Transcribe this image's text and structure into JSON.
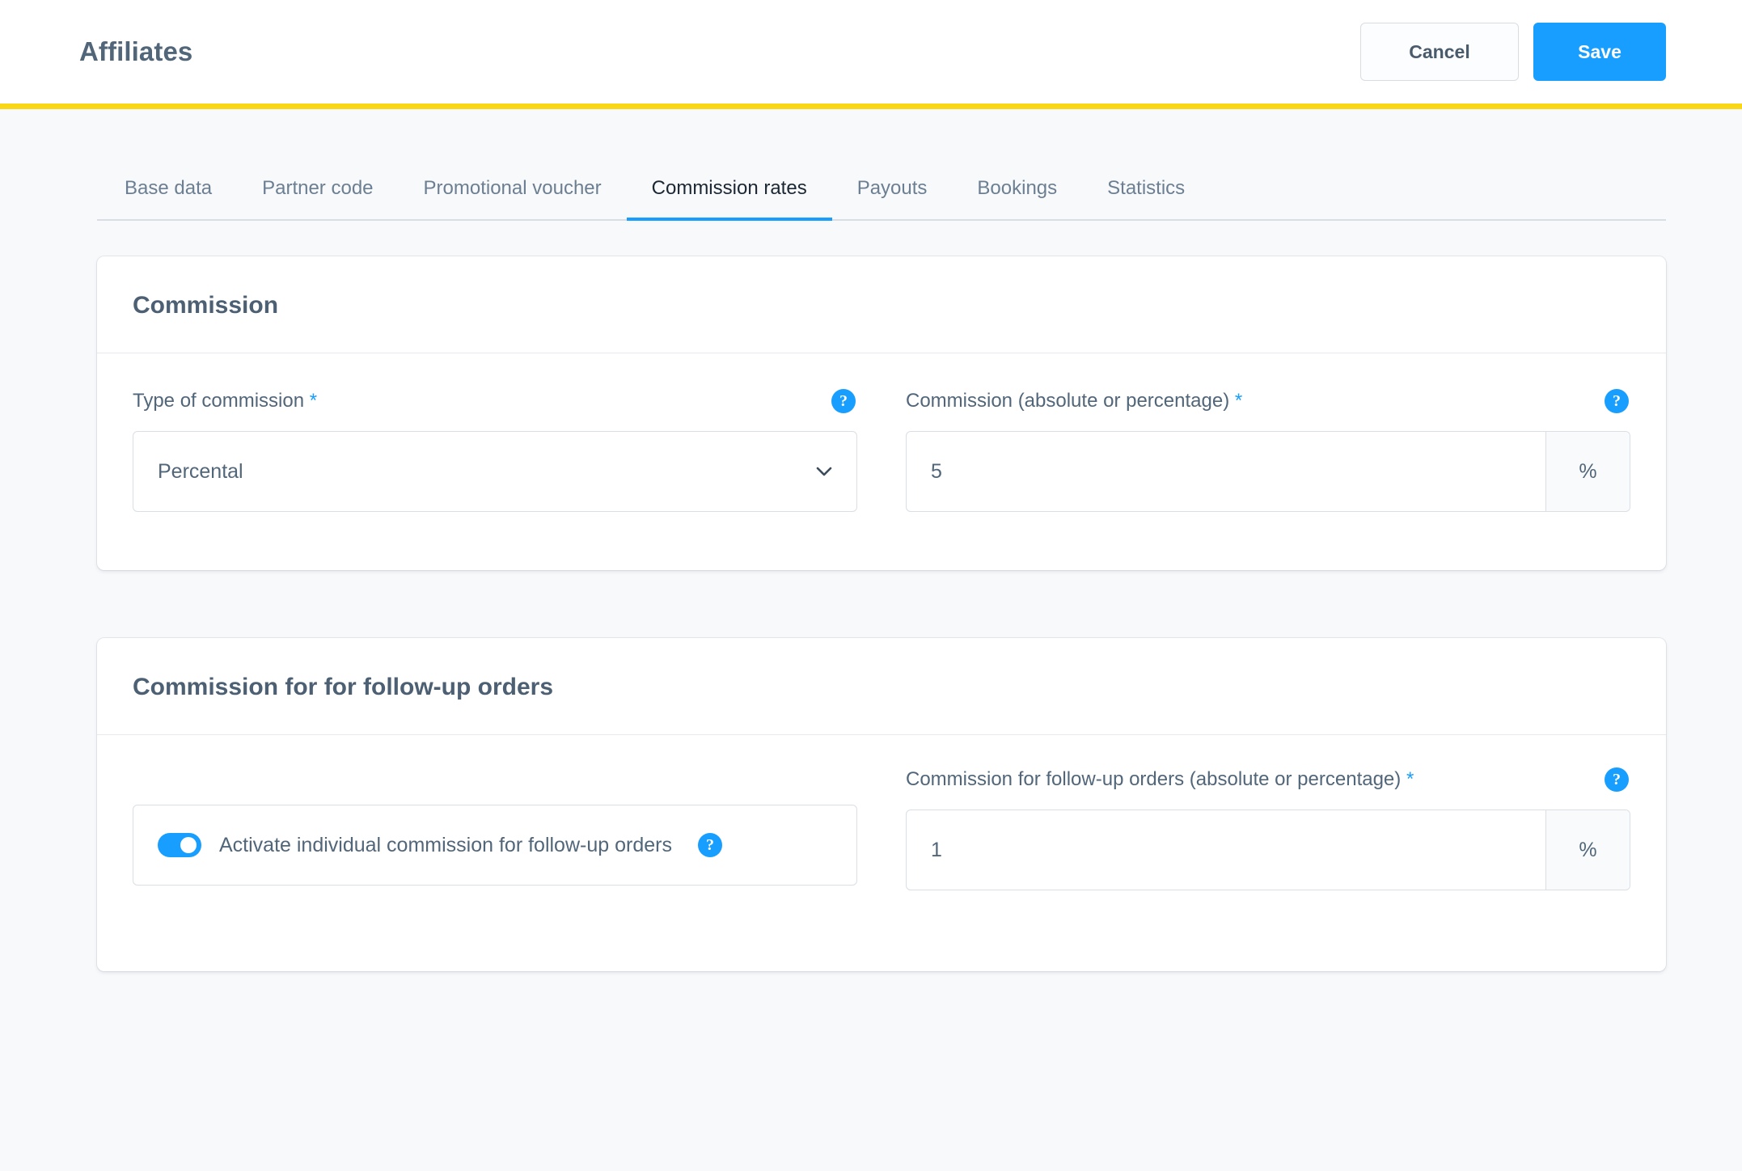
{
  "header": {
    "title": "Affiliates",
    "cancel_label": "Cancel",
    "save_label": "Save",
    "accent_color": "#F9D616",
    "primary_color": "#189EFF"
  },
  "tabs": [
    {
      "label": "Base data",
      "active": false
    },
    {
      "label": "Partner code",
      "active": false
    },
    {
      "label": "Promotional voucher",
      "active": false
    },
    {
      "label": "Commission rates",
      "active": true
    },
    {
      "label": "Payouts",
      "active": false
    },
    {
      "label": "Bookings",
      "active": false
    },
    {
      "label": "Statistics",
      "active": false
    }
  ],
  "commission_card": {
    "title": "Commission",
    "type_field": {
      "label": "Type of commission",
      "required_marker": "*",
      "help": "?",
      "selected_value": "Percental",
      "options": [
        "Percental"
      ]
    },
    "amount_field": {
      "label": "Commission (absolute or percentage)",
      "required_marker": "*",
      "help": "?",
      "value": "5",
      "placeholder": "",
      "unit": "%"
    }
  },
  "followup_card": {
    "title": "Commission for for follow-up orders",
    "toggle": {
      "label": "Activate individual commission for follow-up orders",
      "help": "?",
      "enabled": true
    },
    "amount_field": {
      "label": "Commission for follow-up orders (absolute or percentage)",
      "required_marker": "*",
      "help": "?",
      "value": "1",
      "placeholder": "",
      "unit": "%"
    }
  }
}
